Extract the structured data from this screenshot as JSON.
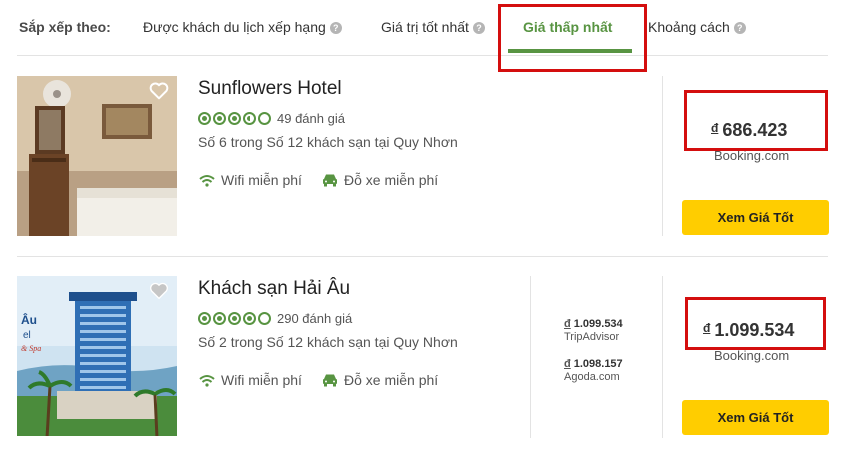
{
  "sort": {
    "label": "Sắp xếp theo:",
    "options": [
      {
        "label": "Được khách du lịch xếp hạng",
        "help": "?"
      },
      {
        "label": "Giá trị tốt nhất",
        "help": "?"
      },
      {
        "label": "Giá thấp nhất",
        "active": true
      },
      {
        "label": "Khoảng cách",
        "help": "?"
      }
    ]
  },
  "hotels": [
    {
      "name": "Sunflowers Hotel",
      "rating": 3.5,
      "reviews": "49 đánh giá",
      "rank": "Số 6 trong Số 12 khách sạn tại Quy Nhơn",
      "amenities": [
        "Wifi miễn phí",
        "Đỗ xe miễn phí"
      ],
      "currency": "đ",
      "price": "686.423",
      "provider": "Booking.com",
      "button": "Xem Giá Tốt",
      "other_prices": []
    },
    {
      "name": "Khách sạn Hải Âu",
      "rating": 4,
      "reviews": "290 đánh giá",
      "rank": "Số 2 trong Số 12 khách sạn tại Quy Nhơn",
      "amenities": [
        "Wifi miễn phí",
        "Đỗ xe miễn phí"
      ],
      "currency": "đ",
      "price": "1.099.534",
      "provider": "Booking.com",
      "button": "Xem Giá Tốt",
      "other_prices": [
        {
          "currency": "đ",
          "price": "1.099.534",
          "provider": "TripAdvisor"
        },
        {
          "currency": "đ",
          "price": "1.098.157",
          "provider": "Agoda.com"
        }
      ],
      "photo_text": [
        "Âu",
        "el",
        "& Spa"
      ]
    }
  ],
  "colors": {
    "accent": "#589442",
    "highlight": "#d40e0e",
    "button": "#ffcd00"
  }
}
